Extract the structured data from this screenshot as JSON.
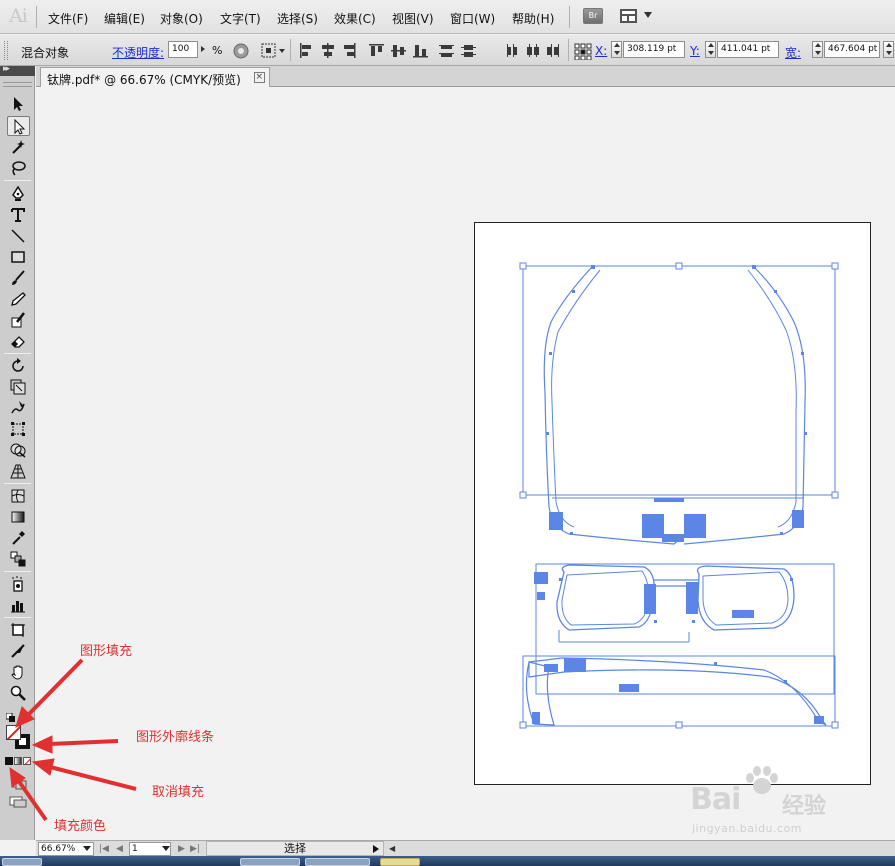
{
  "app": {
    "logo": "Ai",
    "menus": [
      "文件(F)",
      "编辑(E)",
      "对象(O)",
      "文字(T)",
      "选择(S)",
      "效果(C)",
      "视图(V)",
      "窗口(W)",
      "帮助(H)"
    ],
    "bridge_label": "Br"
  },
  "control_bar": {
    "object_type": "混合对象",
    "opacity_label": "不透明度:",
    "opacity_value": "100",
    "opacity_unit": "%",
    "x_label": "X:",
    "x_value": "308.119 pt",
    "y_label": "Y:",
    "y_value": "411.041 pt",
    "w_label": "宽:",
    "w_value": "467.604 pt"
  },
  "document": {
    "tab_title": "钛牌.pdf* @ 66.67% (CMYK/预览)",
    "close_glyph": "×"
  },
  "status_bar": {
    "zoom": "66.67%",
    "page": "1",
    "tool_status": "选择"
  },
  "annotations": {
    "shape_fill": "图形填充",
    "shape_stroke": "图形外廓线条",
    "cancel_fill": "取消填充",
    "fill_color": "填充颜色"
  },
  "toolbox": {
    "fill": "none",
    "stroke": "black",
    "tools": [
      "selection-tool",
      "direct-selection-tool",
      "magic-wand-tool",
      "lasso-tool",
      "pen-tool",
      "type-tool",
      "line-segment-tool",
      "rectangle-tool",
      "paintbrush-tool",
      "pencil-tool",
      "blob-brush-tool",
      "eraser-tool",
      "rotate-tool",
      "scale-tool",
      "warp-tool",
      "free-transform-tool",
      "shape-builder-tool",
      "perspective-grid-tool",
      "mesh-tool",
      "gradient-tool",
      "eyedropper-tool",
      "blend-tool",
      "symbol-sprayer-tool",
      "column-graph-tool",
      "artboard-tool",
      "slice-tool",
      "hand-tool",
      "zoom-tool"
    ]
  },
  "watermark": {
    "brand": "Bai",
    "brand2": "经验",
    "url": "jingyan.baidu.com"
  },
  "colors": {
    "selection_blue": "#5b86e5",
    "annotation_red": "#e03030",
    "link_blue": "#1a2fd0"
  }
}
